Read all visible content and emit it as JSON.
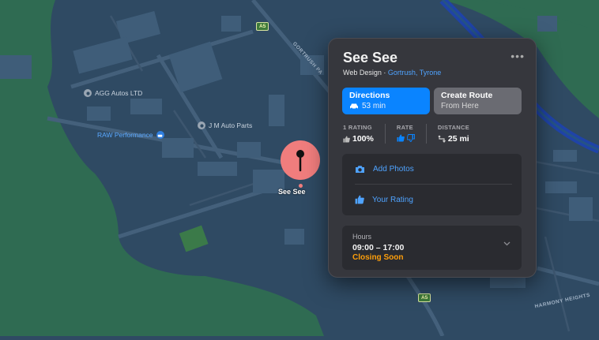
{
  "map": {
    "pois": [
      {
        "name": "AGG Autos LTD",
        "icon": "car-repair-icon"
      },
      {
        "name": "RAW Performance",
        "icon": "car-icon"
      },
      {
        "name": "J M Auto Parts",
        "icon": "car-repair-icon"
      }
    ],
    "road_shields": [
      "A5",
      "A5"
    ],
    "streets": [
      "GORTRUSH PA",
      "HARMONY HEIGHTS"
    ],
    "pin": {
      "label": "See See",
      "color": "#f07d7d",
      "icon": "pushpin-icon"
    }
  },
  "card": {
    "title": "See See",
    "category": "Web Design",
    "separator": "·",
    "location": "Gortrush, Tyrone",
    "more_label": "•••",
    "directions": {
      "label": "Directions",
      "time": "53 min",
      "icon": "car-icon"
    },
    "create_route": {
      "label": "Create Route",
      "sub": "From Here"
    },
    "stats": {
      "rating_header": "1 RATING",
      "rating_value": "100%",
      "rate_header": "RATE",
      "distance_header": "DISTANCE",
      "distance_value": "25 mi"
    },
    "actions": [
      {
        "label": "Add Photos",
        "icon": "camera-icon"
      },
      {
        "label": "Your Rating",
        "icon": "thumbs-up-icon"
      }
    ],
    "hours": {
      "header": "Hours",
      "time": "09:00 – 17:00",
      "status": "Closing Soon"
    }
  },
  "colors": {
    "accent": "#0a84ff",
    "link": "#4fa3ff",
    "warning": "#ff9f0a",
    "pin": "#f07d7d",
    "water": "#1f43a8",
    "land": "#2f6b52",
    "urban": "#2f4a63"
  }
}
